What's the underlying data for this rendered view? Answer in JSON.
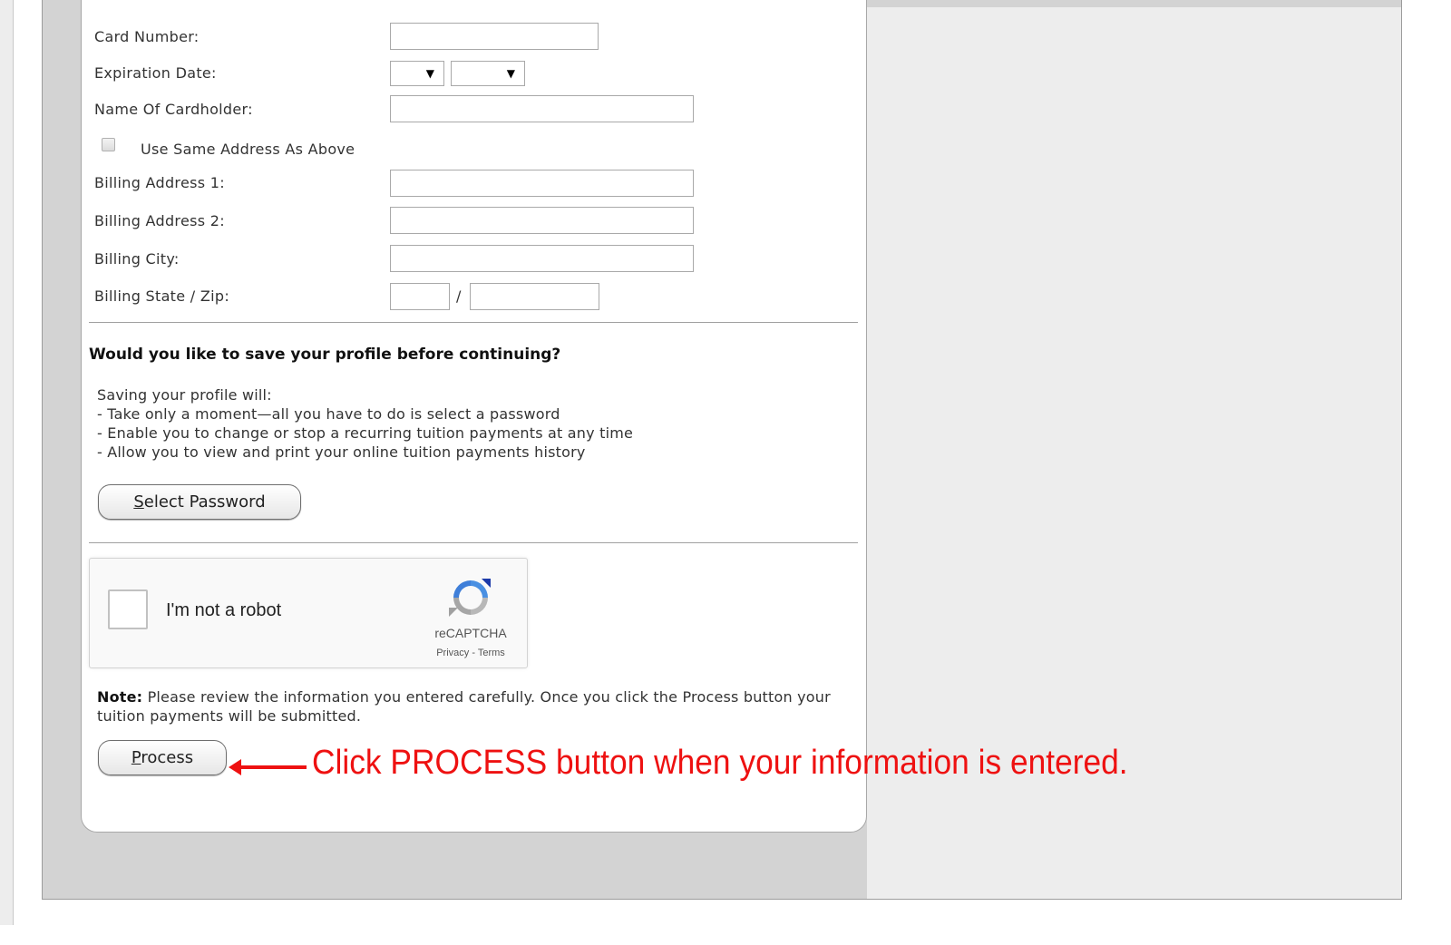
{
  "form": {
    "card_number_label": "Card Number:",
    "expiration_label": "Expiration Date:",
    "expiration_month_value": "",
    "expiration_year_value": "",
    "cardholder_label": "Name Of Cardholder:",
    "same_address_label": "Use Same Address As Above",
    "billing_address1_label": "Billing Address 1:",
    "billing_address2_label": "Billing Address 2:",
    "billing_city_label": "Billing City:",
    "billing_state_zip_label": "Billing State / Zip:",
    "state_zip_separator": "/"
  },
  "save_profile": {
    "heading": "Would you like to save your profile before continuing?",
    "intro": "Saving your profile will:",
    "bullets": [
      "- Take only a moment—all you have to do is select a password",
      "- Enable you to change or stop a recurring tuition payments at any time",
      "- Allow you to view and print your online tuition payments history"
    ],
    "button_prefix": "S",
    "button_rest": "elect Password"
  },
  "captcha": {
    "label": "I'm not a robot",
    "brand": "reCAPTCHA",
    "links": "Privacy - Terms"
  },
  "note": {
    "strong": "Note:",
    "text": " Please review the information you entered carefully. Once you click the Process button your tuition payments will be submitted."
  },
  "process": {
    "button_prefix": "P",
    "button_rest": "rocess"
  },
  "annotation": {
    "text": "Click PROCESS button when your information is entered.",
    "color": "#ee1111"
  }
}
